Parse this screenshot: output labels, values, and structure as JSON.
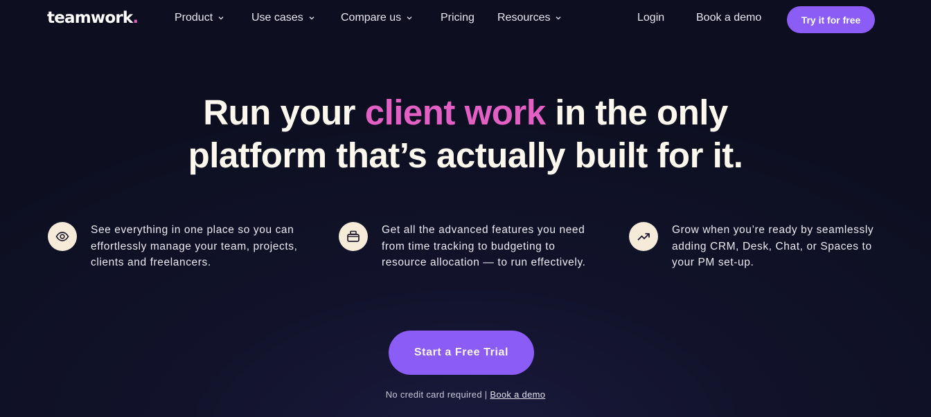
{
  "nav": {
    "logo_text": "teamwork",
    "logo_dot": ".",
    "items": [
      {
        "label": "Product",
        "has_dropdown": true
      },
      {
        "label": "Use cases",
        "has_dropdown": true
      },
      {
        "label": "Compare us",
        "has_dropdown": true
      },
      {
        "label": "Pricing",
        "has_dropdown": false
      },
      {
        "label": "Resources",
        "has_dropdown": true
      }
    ],
    "login_label": "Login",
    "book_demo_label": "Book a demo",
    "try_free_label": "Try it for free"
  },
  "hero": {
    "line1_pre": "Run your ",
    "line1_accent": "client work",
    "line1_post": " in the only",
    "line2": "platform that’s actually built for it."
  },
  "features": [
    {
      "icon": "eye-icon",
      "text": "See everything in one place so you can effortlessly manage your team, projects, clients and freelancers."
    },
    {
      "icon": "toolbox-icon",
      "text": "Get all the advanced features you need from time tracking to budgeting to resource allocation — to run effectively."
    },
    {
      "icon": "trending-up-icon",
      "text": "Grow when you’re ready by seamlessly adding CRM, Desk, Chat, or Spaces to your PM set-up."
    }
  ],
  "cta": {
    "button_label": "Start a Free Trial",
    "note_text": "No credit card required | ",
    "note_link": "Book a demo"
  },
  "colors": {
    "background": "#0d0f21",
    "accent_purple": "#8b5cf6",
    "accent_pink": "#e25fc4",
    "icon_bg": "#f6ead9",
    "text_light": "#fdf8ee"
  }
}
